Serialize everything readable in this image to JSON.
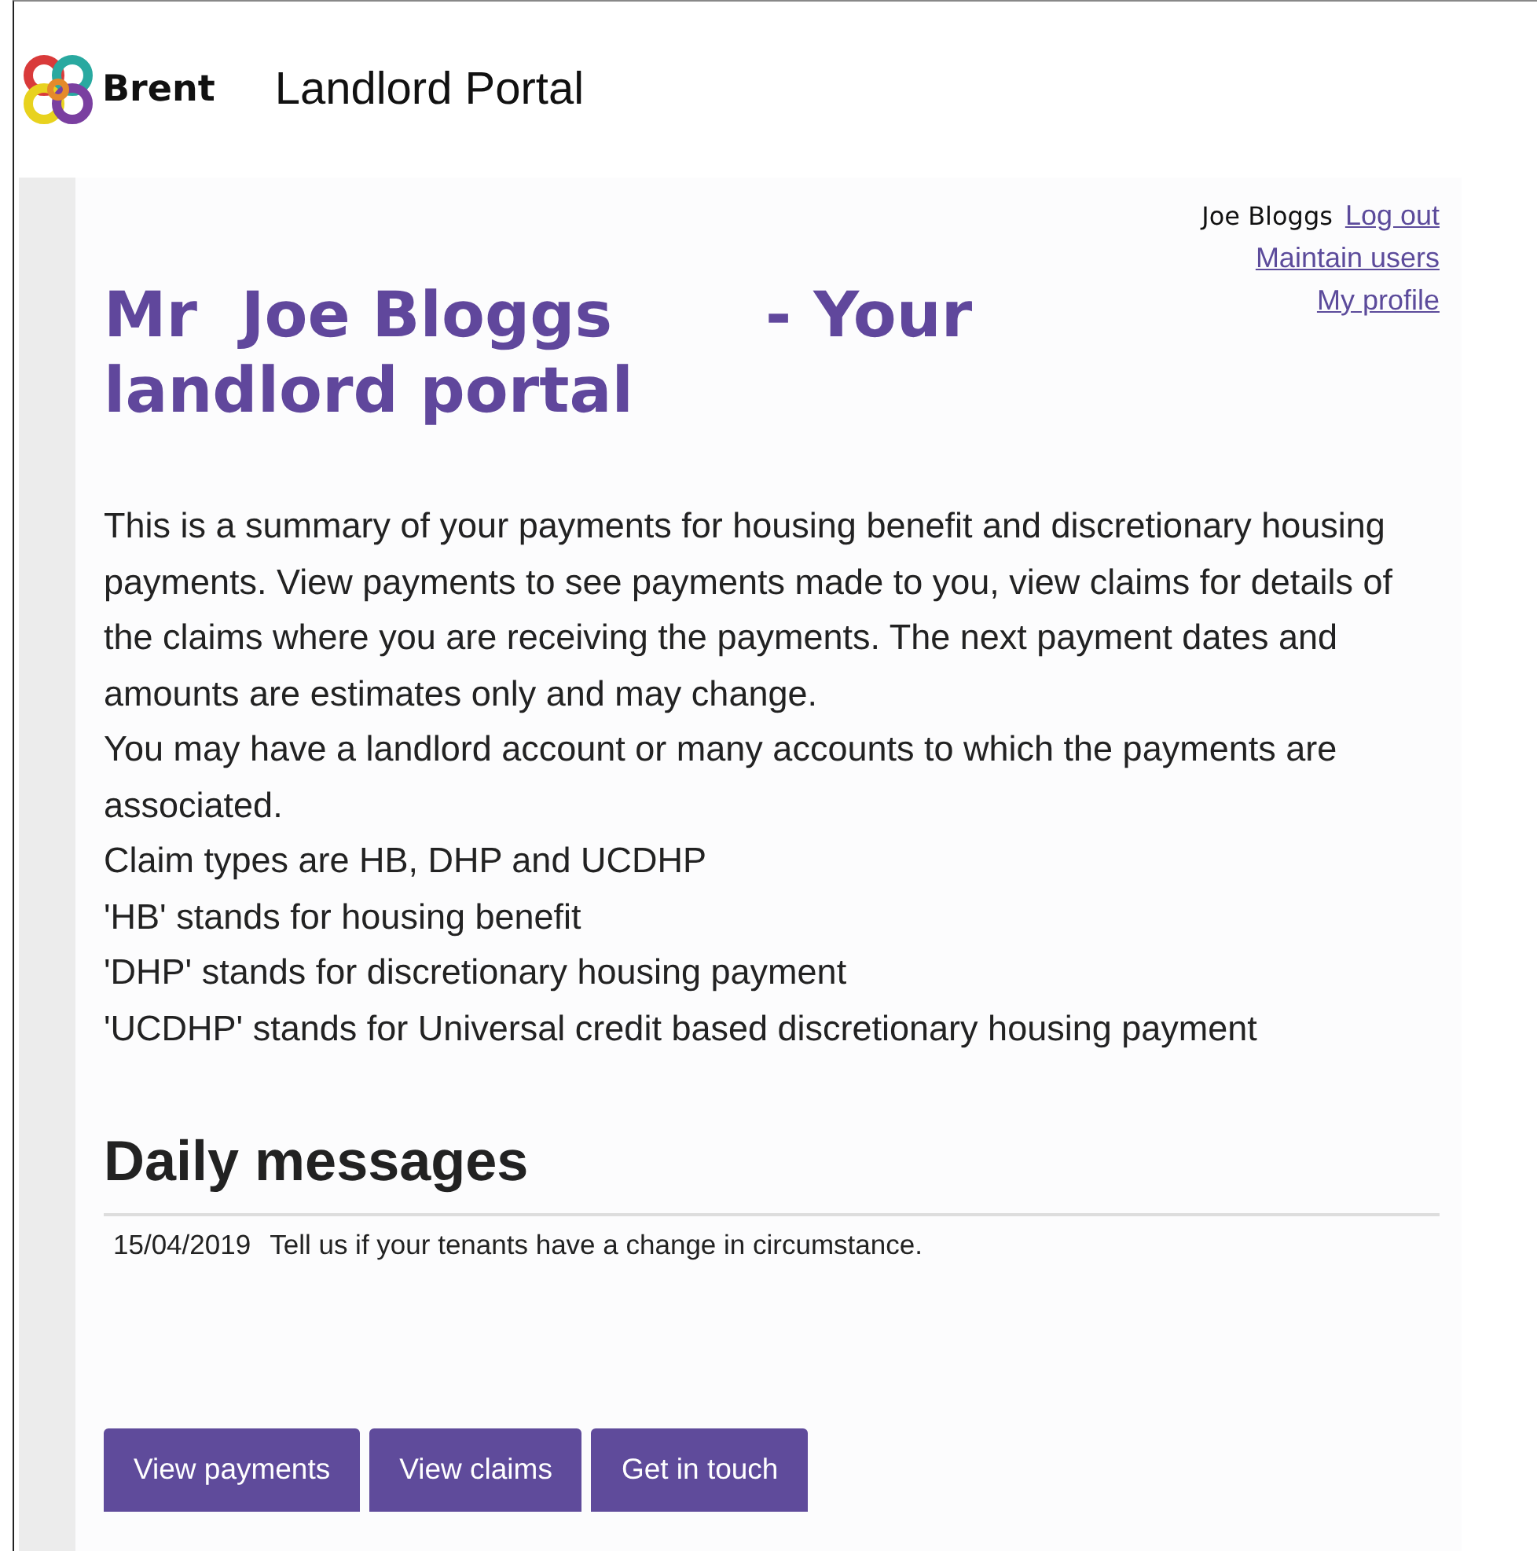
{
  "header": {
    "brand": "Brent",
    "title": "Landlord Portal"
  },
  "user_menu": {
    "user_name": "Joe Bloggs",
    "links": [
      "Log out",
      "Maintain users",
      "My profile"
    ]
  },
  "page_title": "Mr  Joe Bloggs       - Your landlord portal",
  "intro": [
    "This is a summary of your payments for housing benefit and discretionary housing payments. View payments to see payments made to you, view claims for details of the claims where you are receiving the payments. The next payment dates and amounts are estimates only and may change.",
    "You may have a landlord account or many accounts to which the payments are associated.",
    "Claim types are HB, DHP and UCDHP",
    "'HB' stands for housing benefit",
    "'DHP' stands for discretionary housing payment",
    "'UCDHP' stands for Universal credit based discretionary housing payment"
  ],
  "daily_messages": {
    "heading": "Daily messages",
    "messages": [
      {
        "date": "15/04/2019",
        "text": "Tell us if your tenants have a change in circumstance."
      }
    ]
  },
  "buttons": [
    "View payments",
    "View claims",
    "Get in touch"
  ]
}
